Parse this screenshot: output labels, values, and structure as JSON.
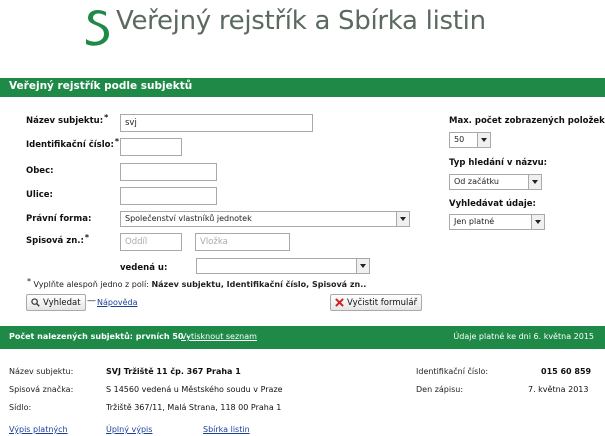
{
  "header": {
    "title": "Veřejný rejstřík a Sbírka listin",
    "logo_color": "#1f8a47"
  },
  "section": {
    "title": "Veřejný rejstřík podle subjektů"
  },
  "form": {
    "subject_name_label": "Název subjektu:",
    "subject_name_value": "svj",
    "ico_label": "Identifikační číslo:",
    "ico_value": "",
    "municipality_label": "Obec:",
    "municipality_value": "",
    "street_label": "Ulice:",
    "street_value": "",
    "legal_form_label": "Právní forma:",
    "legal_form_value": "Společenství vlastníků jednotek",
    "file_no_label": "Spisová zn.:",
    "section_placeholder": "Oddíl",
    "insert_placeholder": "Vložka",
    "kept_at_label": "vedená u:",
    "kept_at_value": "",
    "required_mark": "*",
    "max_results_label": "Max. počet zobrazených položek:",
    "max_results_value": "50",
    "search_type_label": "Typ hledání v názvu:",
    "search_type_value": "Od začátku",
    "search_data_label": "Vyhledávat údaje:",
    "search_data_value": "Jen platné",
    "hint_prefix": "Vyplňte alespoň jedno z polí:",
    "hint_fields": "Název subjektu, Identifikační číslo, Spisová zn..",
    "search_button": "Vyhledat",
    "help_link": "Nápověda",
    "clear_button": "Vyčistit formulář"
  },
  "results": {
    "count_label": "Počet nalezených subjektů: prvních 50 -",
    "print_link": "Vytisknout seznam",
    "valid_as_of": "Údaje platné ke dni 6. května 2015",
    "item": {
      "name_label": "Název subjektu:",
      "name_value": "SVJ Tržiště 11 čp. 367 Praha 1",
      "file_label": "Spisová značka:",
      "file_value": "S 14560 vedená u Městského soudu v Praze",
      "seat_label": "Sídlo:",
      "seat_value": "Tržiště 367/11, Malá Strana, 118 00 Praha 1",
      "ico_label": "Identifikační číslo:",
      "ico_value": "015 60 859",
      "reg_label": "Den zápisu:",
      "reg_value": "7. května 2013",
      "links": [
        "Výpis platných",
        "Úplný výpis",
        "Sbírka listin"
      ]
    }
  },
  "colors": {
    "accent": "#1f8a47",
    "link": "#1a3f9a"
  }
}
